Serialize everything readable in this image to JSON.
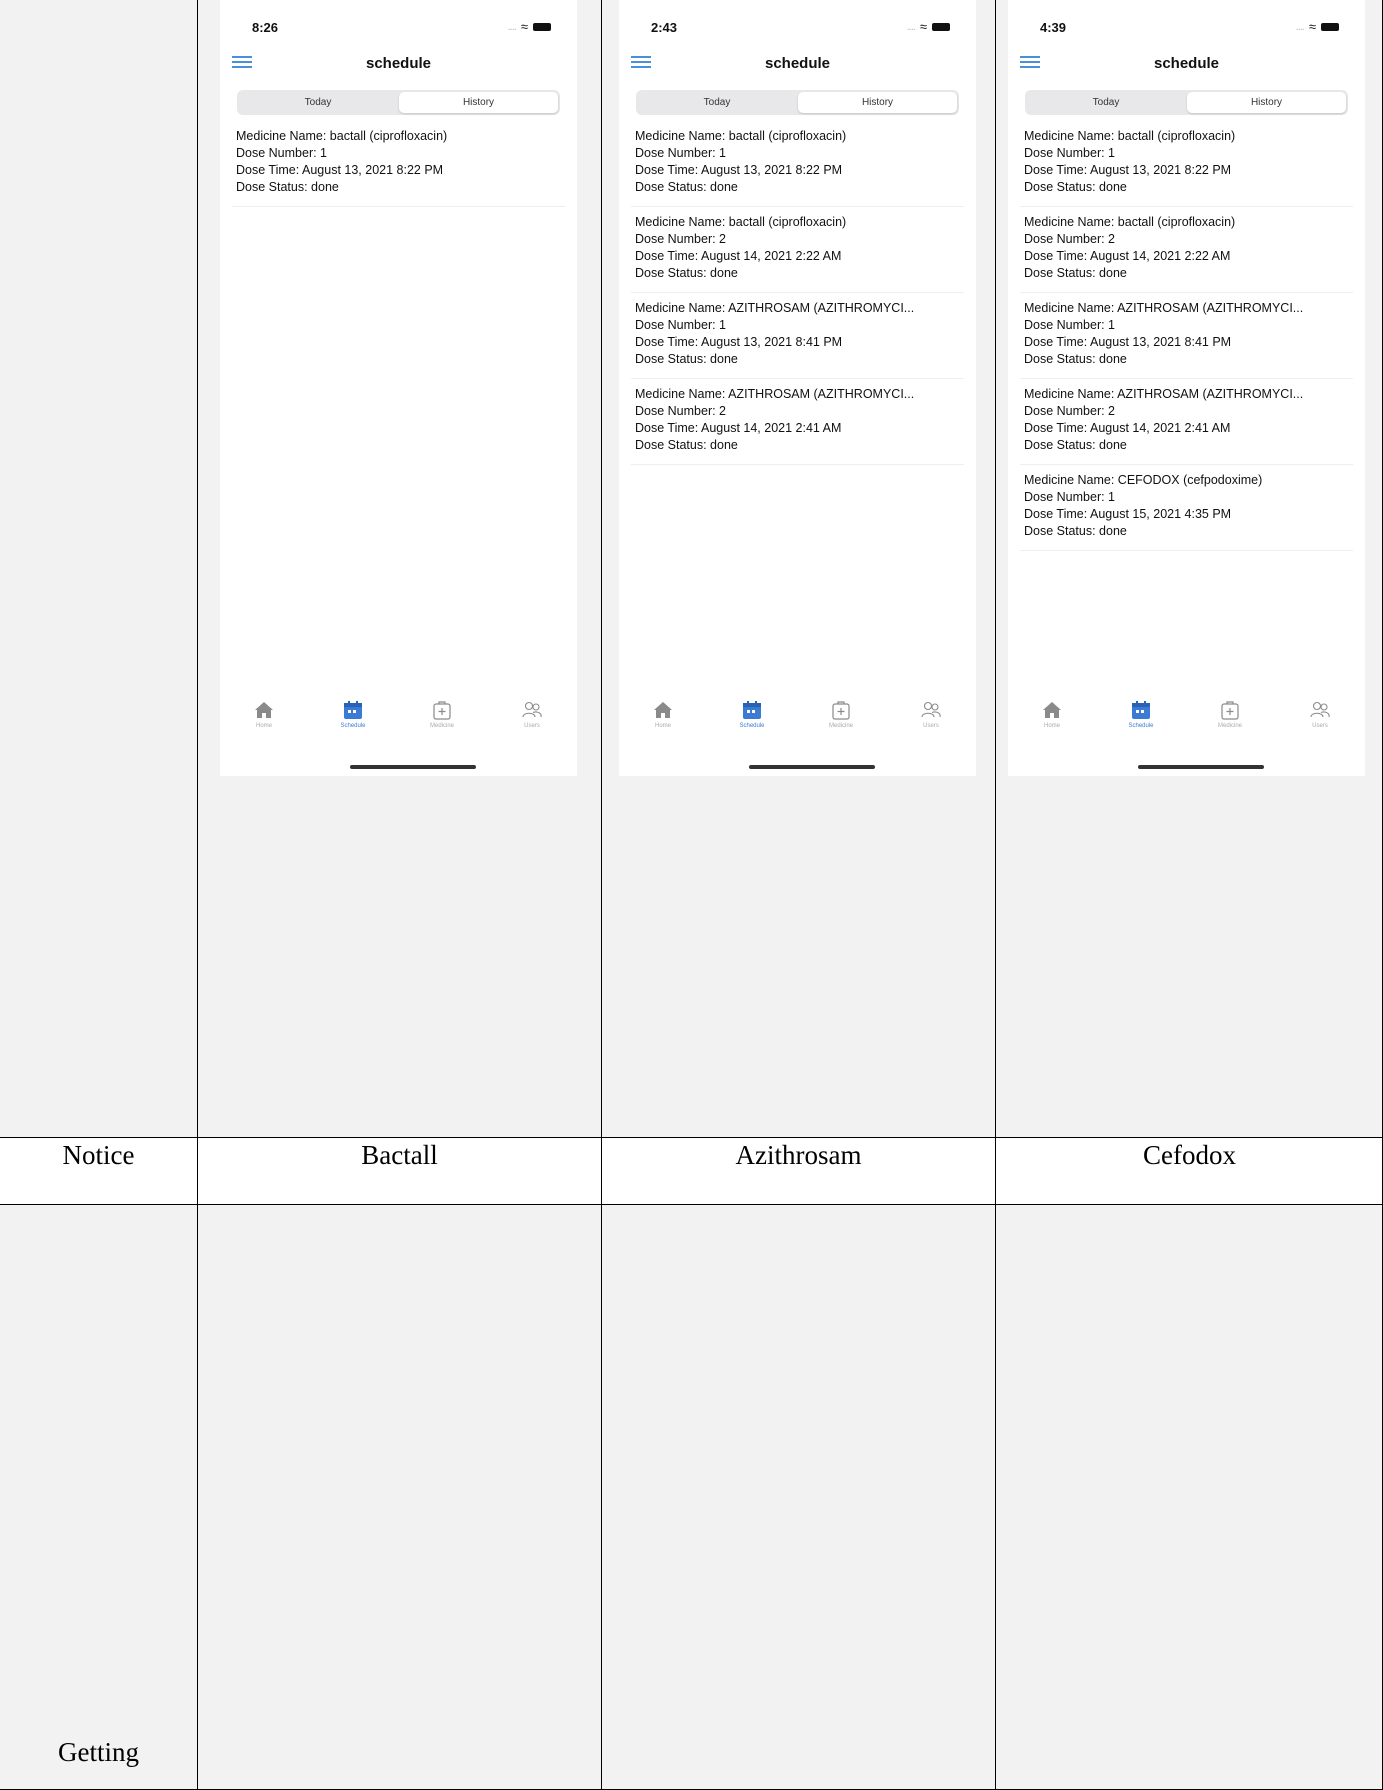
{
  "table": {
    "row_labels": {
      "notice": "Notice",
      "getting": "Getting"
    },
    "columns": [
      {
        "header": "Bactall"
      },
      {
        "header": "Azithrosam"
      },
      {
        "header": "Cefodox"
      }
    ]
  },
  "phones": [
    {
      "time": "8:26",
      "title": "schedule",
      "tabs": {
        "today": "Today",
        "history": "History"
      },
      "entries": [
        {
          "name": "Medicine Name: bactall (ciprofloxacin)",
          "dose": "Dose Number: 1",
          "time": "Dose Time: August 13, 2021 8:22 PM",
          "status": "Dose Status: done"
        }
      ],
      "nav": {
        "home": "Home",
        "schedule": "Schedule",
        "medicine": "Medicine",
        "users": "Users"
      }
    },
    {
      "time": "2:43",
      "title": "schedule",
      "tabs": {
        "today": "Today",
        "history": "History"
      },
      "entries": [
        {
          "name": "Medicine Name: bactall (ciprofloxacin)",
          "dose": "Dose Number: 1",
          "time": "Dose Time: August 13, 2021 8:22 PM",
          "status": "Dose Status: done"
        },
        {
          "name": "Medicine Name: bactall (ciprofloxacin)",
          "dose": "Dose Number: 2",
          "time": "Dose Time: August 14, 2021 2:22 AM",
          "status": "Dose Status: done"
        },
        {
          "name": "Medicine Name: AZITHROSAM (AZITHROMYCI...",
          "dose": "Dose Number: 1",
          "time": "Dose Time: August 13, 2021 8:41 PM",
          "status": "Dose Status: done"
        },
        {
          "name": "Medicine Name: AZITHROSAM (AZITHROMYCI...",
          "dose": "Dose Number: 2",
          "time": "Dose Time: August 14, 2021 2:41 AM",
          "status": "Dose Status: done"
        }
      ],
      "nav": {
        "home": "Home",
        "schedule": "Schedule",
        "medicine": "Medicine",
        "users": "Users"
      }
    },
    {
      "time": "4:39",
      "title": "schedule",
      "tabs": {
        "today": "Today",
        "history": "History"
      },
      "entries": [
        {
          "name": "Medicine Name: bactall (ciprofloxacin)",
          "dose": "Dose Number: 1",
          "time": "Dose Time: August 13, 2021 8:22 PM",
          "status": "Dose Status: done"
        },
        {
          "name": "Medicine Name: bactall (ciprofloxacin)",
          "dose": "Dose Number: 2",
          "time": "Dose Time: August 14, 2021 2:22 AM",
          "status": "Dose Status: done"
        },
        {
          "name": "Medicine Name: AZITHROSAM (AZITHROMYCI...",
          "dose": "Dose Number: 1",
          "time": "Dose Time: August 13, 2021 8:41 PM",
          "status": "Dose Status: done"
        },
        {
          "name": "Medicine Name: AZITHROSAM (AZITHROMYCI...",
          "dose": "Dose Number: 2",
          "time": "Dose Time: August 14, 2021 2:41 AM",
          "status": "Dose Status: done"
        },
        {
          "name": "Medicine Name: CEFODOX (cefpodoxime)",
          "dose": "Dose Number: 1",
          "time": "Dose Time: August 15, 2021 4:35 PM",
          "status": "Dose Status: done"
        }
      ],
      "nav": {
        "home": "Home",
        "schedule": "Schedule",
        "medicine": "Medicine",
        "users": "Users"
      }
    }
  ],
  "colors": {
    "accent": "#3b7bd4",
    "cell_bg": "#f2f2f2",
    "border": "#000000"
  }
}
